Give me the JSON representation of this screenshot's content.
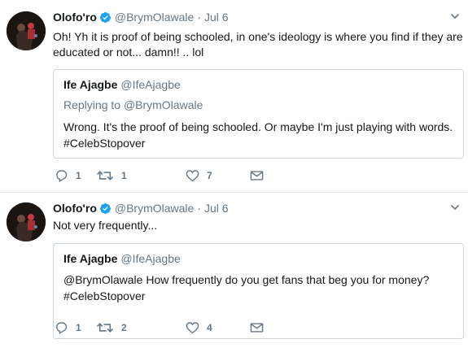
{
  "tweets": [
    {
      "author": {
        "name": "Olofo'ro",
        "handle": "@BrymOlawale",
        "verified": true
      },
      "separator": "·",
      "date": "Jul 6",
      "text": "Oh! Yh it is proof of being schooled, in one's  ideology is where you find if they are educated or not... damn!! .. lol",
      "quote": {
        "name": "Ife Ajagbe",
        "handle": "@IfeAjagbe",
        "replying_label": "Replying to",
        "replying_to": "@BrymOlawale",
        "text_line1": "Wrong. It's the proof of being schooled. Or maybe I'm just playing with words.",
        "text_line2": "#CelebStopover"
      },
      "counts": {
        "reply": "1",
        "retweet": "1",
        "like": "7"
      }
    },
    {
      "author": {
        "name": "Olofo'ro",
        "handle": "@BrymOlawale",
        "verified": true
      },
      "separator": "·",
      "date": "Jul 6",
      "text": "Not very frequently...",
      "quote": {
        "name": "Ife Ajagbe",
        "handle": "@IfeAjagbe",
        "text_line1": "@BrymOlawale How frequently do you get fans that beg you for money?",
        "text_line2": "#CelebStopover"
      },
      "counts": {
        "reply": "1",
        "retweet": "2",
        "like": "4"
      }
    }
  ],
  "colors": {
    "verified": "#1da1f2",
    "text": "#14171a",
    "muted": "#657786",
    "border": "#ccd6dd"
  },
  "icons": [
    "verified-badge-icon",
    "chevron-down-icon",
    "reply-icon",
    "retweet-icon",
    "heart-icon",
    "envelope-icon"
  ]
}
